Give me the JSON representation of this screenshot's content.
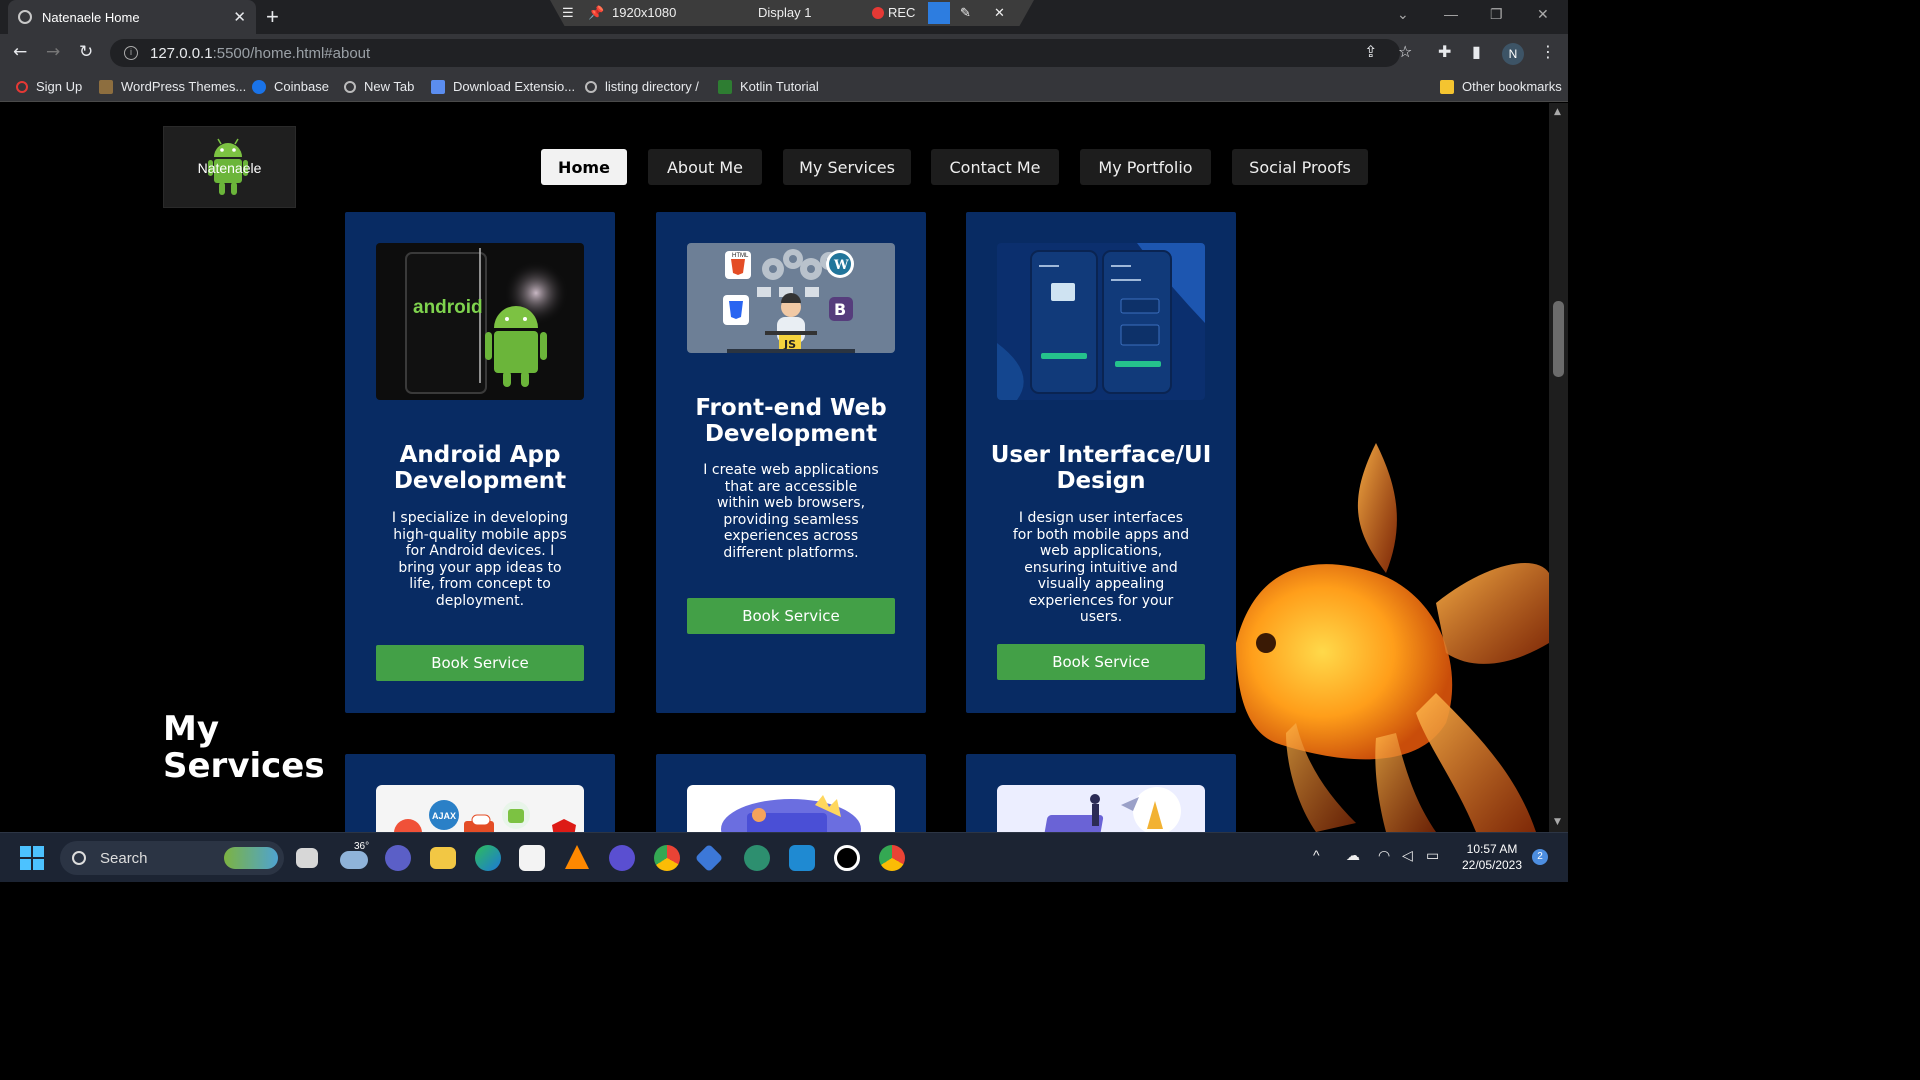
{
  "tab": {
    "title": "Natenaele Home",
    "close": "✕",
    "new": "+"
  },
  "recorder": {
    "resolution": "1920x1080",
    "display": "Display 1",
    "rec": "REC"
  },
  "address": {
    "host": "127.0.0.1",
    "path": ":5500/home.html#about"
  },
  "profile": {
    "initial": "N"
  },
  "bookmarks": {
    "items": [
      "Sign Up",
      "WordPress Themes...",
      "Coinbase",
      "New Tab",
      "Download Extensio...",
      "listing directory /",
      "Kotlin Tutorial"
    ],
    "other": "Other bookmarks"
  },
  "site": {
    "logo_text": "Natenaele",
    "nav": [
      "Home",
      "About Me",
      "My Services",
      "Contact Me",
      "My Portfolio",
      "Social Proofs"
    ],
    "section_title": "My Services",
    "cards": [
      {
        "title": "Android App Development",
        "desc": "I specialize in developing high-quality mobile apps for Android devices. I bring your app ideas to life, from concept to deployment.",
        "button": "Book Service"
      },
      {
        "title": "Front-end Web Development",
        "desc": "I create web applications that are accessible within web browsers, providing seamless experiences across different platforms.",
        "button": "Book Service"
      },
      {
        "title": "User Interface/UI Design",
        "desc": "I design user interfaces for both mobile apps and web applications, ensuring intuitive and visually appealing experiences for your users.",
        "button": "Book Service"
      }
    ],
    "image_labels": {
      "android": "android",
      "js": "JS",
      "html": "HTML",
      "bootstrap": "B",
      "ajax": "AJAX"
    }
  },
  "taskbar": {
    "search": "Search",
    "weather": "36°",
    "time": "10:57 AM",
    "date": "22/05/2023",
    "notifications": "2"
  },
  "colors": {
    "card": "#082b63",
    "button": "#43a047",
    "nav_active": "#f2f2f2",
    "nav": "#1d1d1d"
  }
}
